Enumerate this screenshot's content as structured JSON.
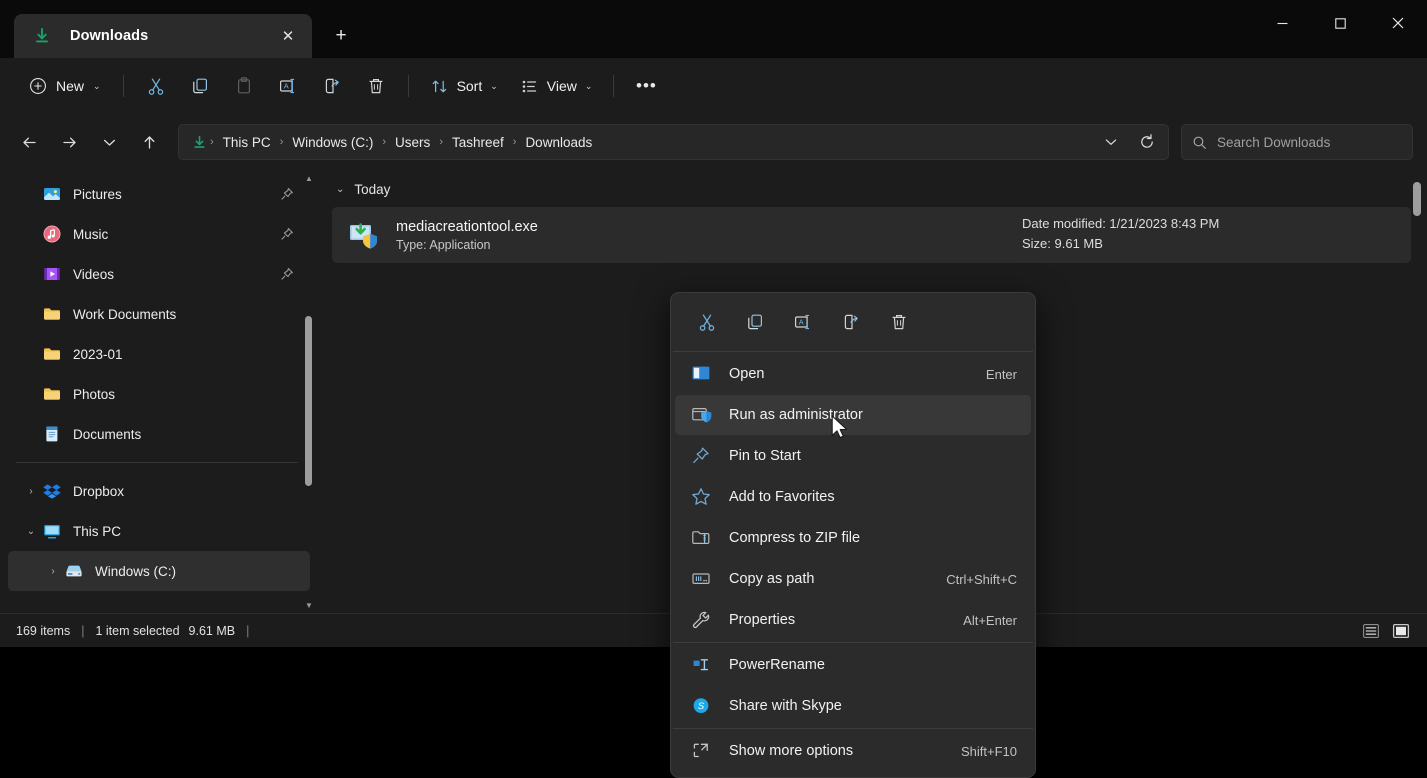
{
  "window": {
    "tab_title": "Downloads",
    "tab_icon": "download-icon",
    "close_label": "✕",
    "new_tab_label": "+",
    "minimize_label": "─",
    "maximize_label": "□",
    "close_window_label": "✕"
  },
  "toolbar": {
    "new_label": "New",
    "sort_label": "Sort",
    "view_label": "View",
    "more_label": "•••",
    "chevron": "⌄",
    "buttons": [
      {
        "name": "cut-button",
        "icon": "scissors-icon"
      },
      {
        "name": "copy-button",
        "icon": "copy-icon"
      },
      {
        "name": "paste-button",
        "icon": "clipboard-icon"
      },
      {
        "name": "rename-button",
        "icon": "rename-icon"
      },
      {
        "name": "share-button",
        "icon": "share-icon"
      },
      {
        "name": "delete-button",
        "icon": "trash-icon"
      }
    ]
  },
  "address": {
    "back": "←",
    "forward": "→",
    "recent": "⌄",
    "up": "↑",
    "path_icon": "download-icon",
    "crumbs": [
      "This PC",
      "Windows (C:)",
      "Users",
      "Tashreef",
      "Downloads"
    ],
    "separator": "›",
    "dropdown": "⌄",
    "refresh": "↻"
  },
  "search": {
    "placeholder": "Search Downloads",
    "icon": "search-icon"
  },
  "sidebar": {
    "items": [
      {
        "label": "Pictures",
        "icon": "pictures-icon",
        "pinned": true,
        "indent": 0,
        "expander": "",
        "selected": false
      },
      {
        "label": "Music",
        "icon": "music-icon",
        "pinned": true,
        "indent": 0,
        "expander": "",
        "selected": false
      },
      {
        "label": "Videos",
        "icon": "videos-icon",
        "pinned": true,
        "indent": 0,
        "expander": "",
        "selected": false
      },
      {
        "label": "Work Documents",
        "icon": "folder-icon",
        "pinned": false,
        "indent": 0,
        "expander": "",
        "selected": false
      },
      {
        "label": "2023-01",
        "icon": "folder-icon",
        "pinned": false,
        "indent": 0,
        "expander": "",
        "selected": false
      },
      {
        "label": "Photos",
        "icon": "folder-icon",
        "pinned": false,
        "indent": 0,
        "expander": "",
        "selected": false
      },
      {
        "label": "Documents",
        "icon": "documents-icon",
        "pinned": false,
        "indent": 0,
        "expander": "",
        "selected": false
      }
    ],
    "tree": [
      {
        "label": "Dropbox",
        "icon": "dropbox-icon",
        "expander": "›",
        "indent": 0,
        "selected": false
      },
      {
        "label": "This PC",
        "icon": "pc-icon",
        "expander": "⌄",
        "indent": 0,
        "selected": false
      },
      {
        "label": "Windows (C:)",
        "icon": "drive-icon",
        "expander": "›",
        "indent": 1,
        "selected": true
      }
    ]
  },
  "content": {
    "group_label": "Today",
    "group_chevron": "⌄",
    "file": {
      "name": "mediacreationtool.exe",
      "type": "Type: Application",
      "date_modified": "Date modified: 1/21/2023 8:43 PM",
      "size": "Size: 9.61 MB",
      "icon": "application-shield-icon"
    }
  },
  "context_menu": {
    "top_actions": [
      {
        "name": "ctx-cut-button",
        "icon": "scissors-icon"
      },
      {
        "name": "ctx-copy-button",
        "icon": "copy-icon"
      },
      {
        "name": "ctx-rename-button",
        "icon": "rename-icon"
      },
      {
        "name": "ctx-share-button",
        "icon": "share-icon"
      },
      {
        "name": "ctx-delete-button",
        "icon": "trash-icon"
      }
    ],
    "items": [
      {
        "label": "Open",
        "shortcut": "Enter",
        "icon": "open-window-icon",
        "active": false
      },
      {
        "label": "Run as administrator",
        "shortcut": "",
        "icon": "shield-icon",
        "active": true
      },
      {
        "label": "Pin to Start",
        "shortcut": "",
        "icon": "pin-icon",
        "active": false
      },
      {
        "label": "Add to Favorites",
        "shortcut": "",
        "icon": "star-icon",
        "active": false
      },
      {
        "label": "Compress to ZIP file",
        "shortcut": "",
        "icon": "zip-folder-icon",
        "active": false
      },
      {
        "label": "Copy as path",
        "shortcut": "Ctrl+Shift+C",
        "icon": "copy-path-icon",
        "active": false
      },
      {
        "label": "Properties",
        "shortcut": "Alt+Enter",
        "icon": "wrench-icon",
        "active": false
      }
    ],
    "items2": [
      {
        "label": "PowerRename",
        "shortcut": "",
        "icon": "powerrename-icon",
        "active": false
      },
      {
        "label": "Share with Skype",
        "shortcut": "",
        "icon": "skype-icon",
        "active": false
      }
    ],
    "items3": [
      {
        "label": "Show more options",
        "shortcut": "Shift+F10",
        "icon": "more-options-icon",
        "active": false
      }
    ]
  },
  "statusbar": {
    "items_count": "169 items",
    "sep": "|",
    "selection": "1 item selected",
    "selection_size": "9.61 MB",
    "sep2": "|",
    "view_details": "details-view-icon",
    "view_large": "large-icons-view-icon"
  },
  "colors": {
    "accent": "#4cc2ff",
    "download_green": "#1e9e6a",
    "window_bg": "#1c1c1c",
    "menu_bg": "#2b2b2b",
    "selected_row": "#2f2f2f"
  }
}
